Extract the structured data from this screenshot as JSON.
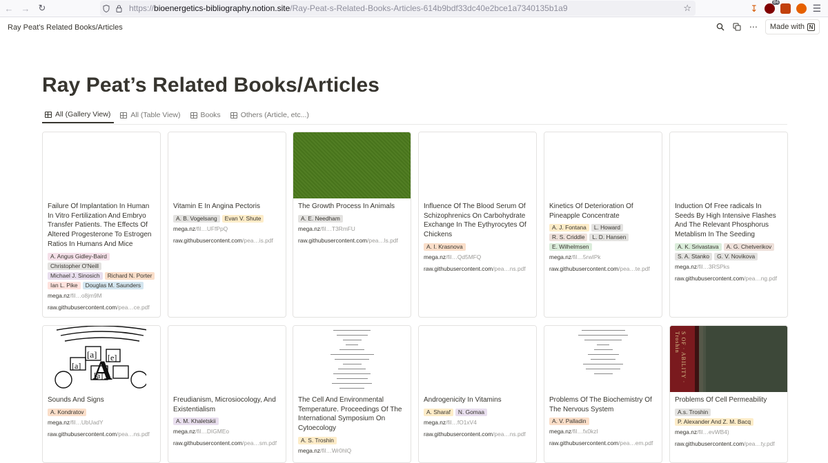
{
  "browser": {
    "url_proto": "https://",
    "url_host": "bioenergetics-bibliography.notion.site",
    "url_path": "/Ray-Peat-s-Related-Books-Articles-614b9bdf33dc40e2bce1a7340135b1a9",
    "ublock_count": "84"
  },
  "topbar": {
    "breadcrumb": "Ray Peat’s Related Books/Articles",
    "made_with": "Made with"
  },
  "page": {
    "title": "Ray Peat’s Related Books/Articles",
    "tabs": [
      "All (Gallery View)",
      "All (Table View)",
      "Books",
      "Others (Article, etc...)"
    ]
  },
  "tag_colors": {
    "gray": "#e3e2e0",
    "orange": "#fadec9",
    "yellow": "#fdecc8",
    "green": "#dbeddb",
    "purple": "#e8deee",
    "pink": "#f5e0e9",
    "red": "#ffe2dd",
    "blue": "#d3e5ef",
    "brown": "#eee0da"
  },
  "cards": [
    {
      "title": "Failure Of Implantation In Human In Vitro Fertilization And Embryo Transfer Patients. The Effects Of Altered Progesterone To Estrogen Ratios In Humans And Mice",
      "cover": "blank",
      "tags": [
        {
          "text": "A. Angus Gidley-Baird",
          "color": "pink"
        },
        {
          "text": "Christopher O'Neill",
          "color": "gray"
        },
        {
          "text": "Michael J. Sinosich",
          "color": "purple"
        },
        {
          "text": "Richard N. Porter",
          "color": "orange"
        },
        {
          "text": "Ian L. Pike",
          "color": "red"
        },
        {
          "text": "Douglas M. Saunders",
          "color": "blue"
        }
      ],
      "link1_a": "mega.nz",
      "link1_b": "/fil…o8jm9M",
      "link2_a": "raw.githubusercontent.com",
      "link2_b": "/pea…ce.pdf"
    },
    {
      "title": "Vitamin E In Angina Pectoris",
      "cover": "blank",
      "tags": [
        {
          "text": "A. B. Vogelsang",
          "color": "gray"
        },
        {
          "text": "Evan V. Shute",
          "color": "yellow"
        }
      ],
      "link1_a": "mega.nz",
      "link1_b": "/fil…UFfPpQ",
      "link2_a": "raw.githubusercontent.com",
      "link2_b": "/pea…is.pdf"
    },
    {
      "title": "The Growth Process In Animals",
      "cover": "green",
      "tags": [
        {
          "text": "A. E. Needham",
          "color": "gray"
        }
      ],
      "link1_a": "mega.nz",
      "link1_b": "/fil…T3RmFU",
      "link2_a": "raw.githubusercontent.com",
      "link2_b": "/pea…ls.pdf"
    },
    {
      "title": "Influence Of The Blood Serum Of Schizophrenics On Carbohydrate Exchange In The Eythyrocytes Of Chickens",
      "cover": "blank",
      "tags": [
        {
          "text": "A. I. Krasnova",
          "color": "orange"
        }
      ],
      "link1_a": "mega.nz",
      "link1_b": "/fil…Qd5MFQ",
      "link2_a": "raw.githubusercontent.com",
      "link2_b": "/pea…ns.pdf"
    },
    {
      "title": "Kinetics Of Deterioration Of Pineapple Concentrate",
      "cover": "blank",
      "tags": [
        {
          "text": "A. J. Fontana",
          "color": "yellow"
        },
        {
          "text": "L. Howard",
          "color": "gray"
        },
        {
          "text": "R. S. Criddle",
          "color": "brown"
        },
        {
          "text": "L. D. Hansen",
          "color": "gray"
        },
        {
          "text": "E. Wilhelmsen",
          "color": "green"
        }
      ],
      "link1_a": "mega.nz",
      "link1_b": "/fil…5rwIPk",
      "link2_a": "raw.githubusercontent.com",
      "link2_b": "/pea…te.pdf"
    },
    {
      "title": "Induction Of Free radicals In Seeds By High Intensive Flashes And The Relevant Phosphorus Metablism In The Seeding",
      "cover": "blank",
      "tags": [
        {
          "text": "A. K. Srivastava",
          "color": "green"
        },
        {
          "text": "A. G. Chetverikov",
          "color": "brown"
        },
        {
          "text": "S. A. Stanko",
          "color": "gray"
        },
        {
          "text": "G. V. Novikova",
          "color": "gray"
        }
      ],
      "link1_a": "mega.nz",
      "link1_b": "/fil…3RSPks",
      "link2_a": "raw.githubusercontent.com",
      "link2_b": "/pea…ng.pdf"
    },
    {
      "title": "Sounds And Signs",
      "cover": "illustration",
      "tags": [
        {
          "text": "A. Kondratov",
          "color": "orange"
        }
      ],
      "link1_a": "mega.nz",
      "link1_b": "/fil…UbUadY",
      "link2_a": "raw.githubusercontent.com",
      "link2_b": "/pea…ns.pdf"
    },
    {
      "title": "Freudianism, Microsiocology, And Existentialism",
      "cover": "blank",
      "tags": [
        {
          "text": "A. M. Khaletskii",
          "color": "purple"
        }
      ],
      "link1_a": "mega.nz",
      "link1_b": "/fil…DIGMEo",
      "link2_a": "raw.githubusercontent.com",
      "link2_b": "/pea…sm.pdf"
    },
    {
      "title": "The Cell And Environmental Temperature. Proceedings Of The International Symposium On Cytoecology",
      "cover": "document",
      "tags": [
        {
          "text": "A. S. Troshin",
          "color": "yellow"
        }
      ],
      "link1_a": "mega.nz",
      "link1_b": "/fil…Wr0hlQ",
      "link2_a": "",
      "link2_b": ""
    },
    {
      "title": "Androgenicity In Vitamins",
      "cover": "blank",
      "tags": [
        {
          "text": "A. Sharaf",
          "color": "yellow"
        },
        {
          "text": "N. Gomaa",
          "color": "purple"
        }
      ],
      "link1_a": "mega.nz",
      "link1_b": "/fil…fO1xV4",
      "link2_a": "raw.githubusercontent.com",
      "link2_b": "/pea…ns.pdf"
    },
    {
      "title": "Problems Of The Biochemistry Of The Nervous System",
      "cover": "document2",
      "tags": [
        {
          "text": "A. V. Palladin",
          "color": "orange"
        }
      ],
      "link1_a": "mega.nz",
      "link1_b": "/fil…fx0kzI",
      "link2_a": "raw.githubusercontent.com",
      "link2_b": "/pea…em.pdf"
    },
    {
      "title": "Problems Of Cell Permeability",
      "cover": "book",
      "tags": [
        {
          "text": "A.s. Troshin",
          "color": "gray"
        },
        {
          "text": "P. Alexander And Z. M. Bacq",
          "color": "yellow"
        }
      ],
      "link1_a": "mega.nz",
      "link1_b": "/fil…evWB4)",
      "link2_a": "raw.githubusercontent.com",
      "link2_b": "/pea…ty.pdf"
    }
  ]
}
